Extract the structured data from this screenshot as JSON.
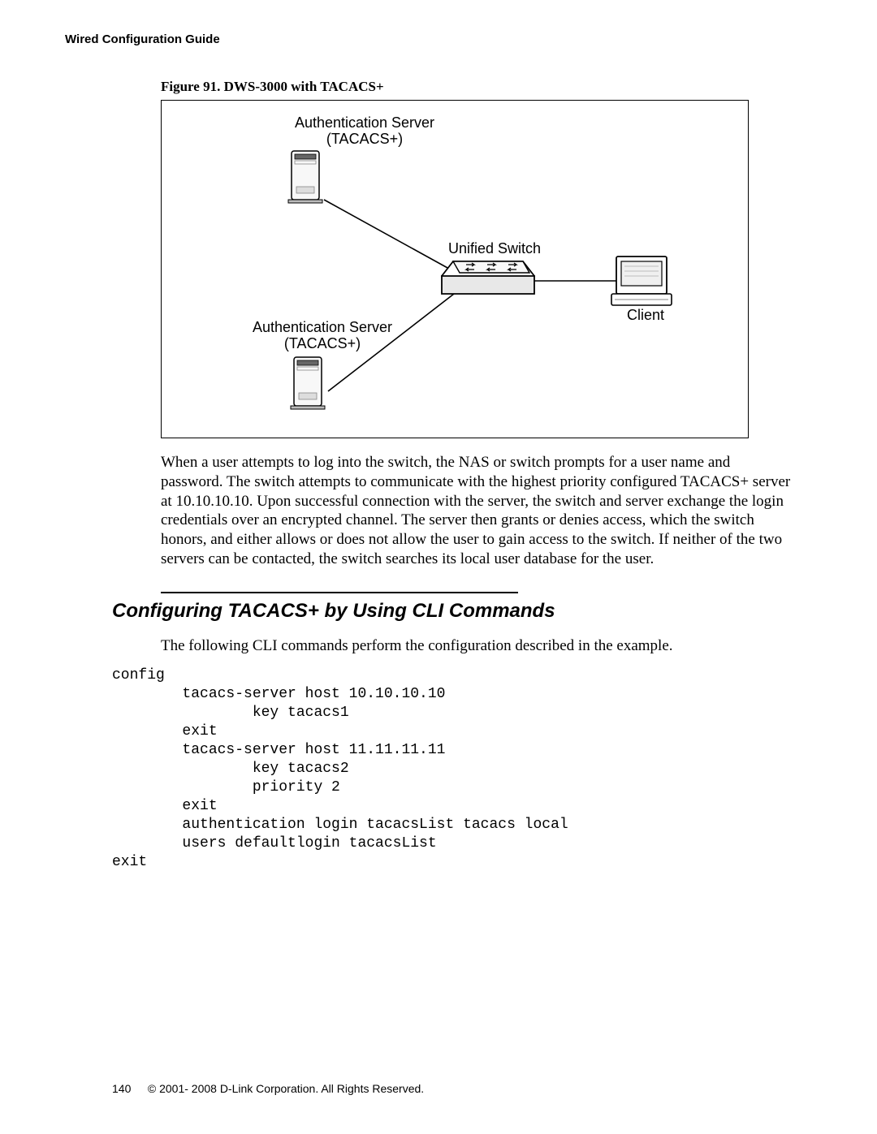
{
  "header": {
    "title": "Wired Configuration Guide"
  },
  "figure": {
    "lead": "Figure 91. ",
    "title": "DWS-3000 with TACACS+",
    "labels": {
      "auth_top_1": "Authentication Server",
      "auth_top_2": "(TACACS+)",
      "unified": "Unified Switch",
      "client": "Client",
      "auth_bot_1": "Authentication Server",
      "auth_bot_2": "(TACACS+)"
    }
  },
  "body_para": "When a user attempts to log into the switch, the NAS or switch prompts for a user name and password. The switch attempts to communicate with the highest priority configured TACACS+ server at 10.10.10.10. Upon successful connection with the server, the switch and server exchange the login credentials over an encrypted channel. The server then grants or denies access, which the switch honors, and either allows or does not allow the user to gain access to the switch. If neither of the two servers can be contacted, the switch searches its local user database for the user.",
  "section_heading": "Configuring TACACS+ by Using CLI Commands",
  "intro_line": "The following CLI commands perform the configuration described in the example.",
  "cli": "config\n        tacacs-server host 10.10.10.10\n                key tacacs1\n        exit\n        tacacs-server host 11.11.11.11\n                key tacacs2\n                priority 2\n        exit\n        authentication login tacacsList tacacs local\n        users defaultlogin tacacsList\nexit",
  "footer": {
    "page": "140",
    "copyright": "© 2001- 2008 D-Link Corporation. All Rights Reserved."
  }
}
